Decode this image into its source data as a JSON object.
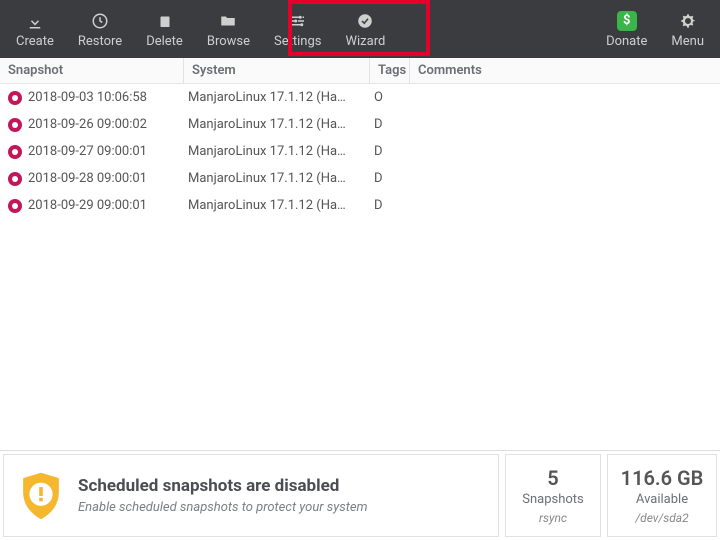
{
  "toolbar": {
    "create": "Create",
    "restore": "Restore",
    "delete": "Delete",
    "browse": "Browse",
    "settings": "Settings",
    "wizard": "Wizard",
    "donate": "Donate",
    "menu": "Menu"
  },
  "headers": {
    "snapshot": "Snapshot",
    "system": "System",
    "tags": "Tags",
    "comments": "Comments"
  },
  "rows": [
    {
      "date": "2018-09-03 10:06:58",
      "system": "ManjaroLinux 17.1.12 (Ha…",
      "tag": "O"
    },
    {
      "date": "2018-09-26 09:00:02",
      "system": "ManjaroLinux 17.1.12 (Ha…",
      "tag": "D"
    },
    {
      "date": "2018-09-27 09:00:01",
      "system": "ManjaroLinux 17.1.12 (Ha…",
      "tag": "D"
    },
    {
      "date": "2018-09-28 09:00:01",
      "system": "ManjaroLinux 17.1.12 (Ha…",
      "tag": "D"
    },
    {
      "date": "2018-09-29 09:00:01",
      "system": "ManjaroLinux 17.1.12 (Ha…",
      "tag": "D"
    }
  ],
  "status": {
    "title": "Scheduled snapshots are disabled",
    "subtitle": "Enable scheduled snapshots to protect your system",
    "count": "5",
    "count_label": "Snapshots",
    "count_sub": "rsync",
    "space": "116.6 GB",
    "space_label": "Available",
    "space_sub": "/dev/sda2"
  }
}
